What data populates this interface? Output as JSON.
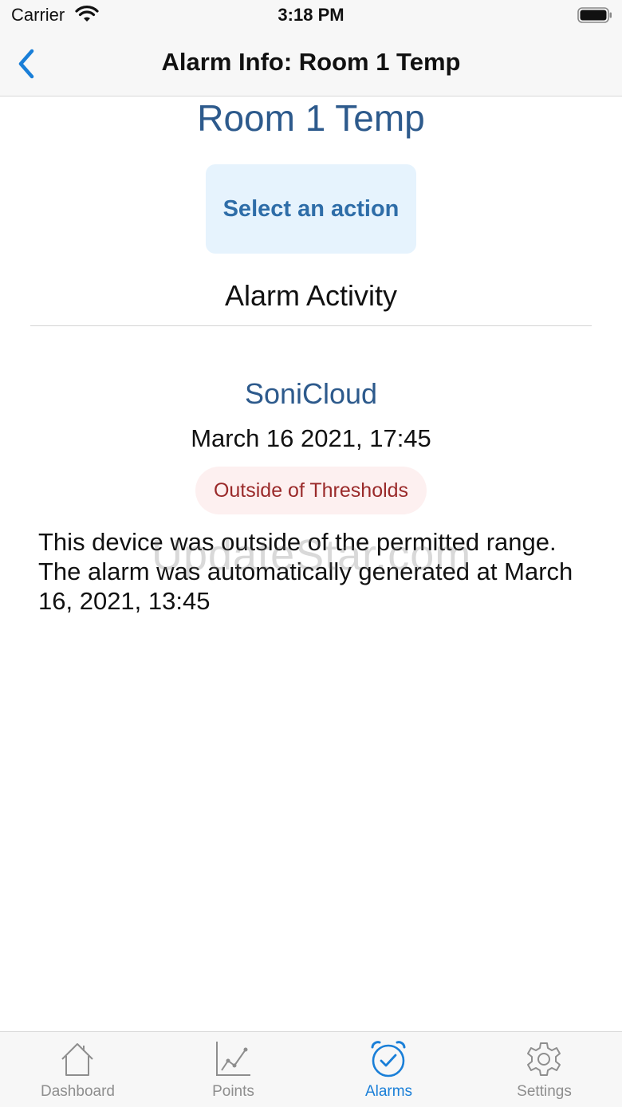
{
  "status_bar": {
    "carrier": "Carrier",
    "time": "3:18 PM",
    "wifi_icon": "wifi-icon",
    "battery_icon": "battery-icon"
  },
  "nav": {
    "back_icon": "chevron-left-icon",
    "title": "Alarm Info: Room 1 Temp"
  },
  "main": {
    "device_title": "Room 1 Temp",
    "action_button_label": "Select an action",
    "activity_heading": "Alarm Activity",
    "activity": {
      "source": "SoniCloud",
      "date": "March 16 2021, 17:45",
      "status": "Outside of Thresholds",
      "description": "This device was outside of the permitted range. The alarm was automatically generated at March 16, 2021, 13:45"
    },
    "watermark": "UpdateStar.com"
  },
  "tabs": [
    {
      "label": "Dashboard",
      "icon": "house-icon",
      "active": false
    },
    {
      "label": "Points",
      "icon": "line-chart-icon",
      "active": false
    },
    {
      "label": "Alarms",
      "icon": "alarm-clock-icon",
      "active": true
    },
    {
      "label": "Settings",
      "icon": "gear-icon",
      "active": false
    }
  ],
  "colors": {
    "accent": "#1a7fd8",
    "title_blue": "#2d5a8c",
    "button_background": "#e6f3fd",
    "button_text": "#2e6da8",
    "badge_background": "#fdf0f0",
    "badge_text": "#9a2a2a",
    "tab_inactive": "#8e8e8e"
  }
}
